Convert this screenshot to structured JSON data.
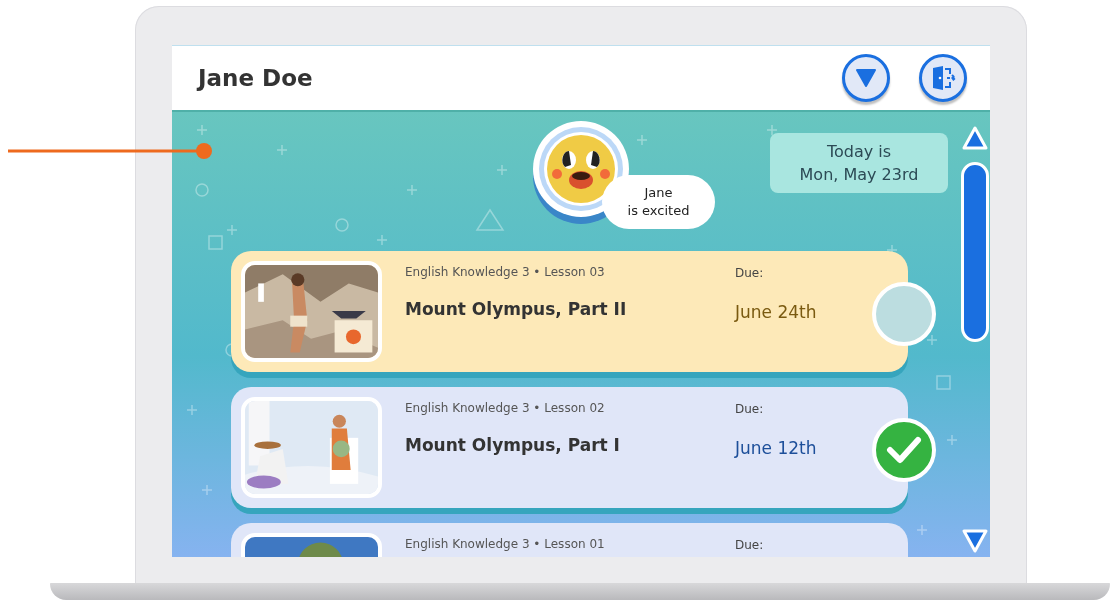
{
  "header": {
    "user_name": "Jane Doe"
  },
  "mood": {
    "name": "Jane",
    "status": "is excited"
  },
  "date": {
    "label": "Today is",
    "value": "Mon, May 23rd"
  },
  "lessons": [
    {
      "course": "English Knowledge 3 • Lesson 03",
      "title": "Mount Olympus, Part II",
      "due_label": "Due:",
      "due": "June 24th",
      "current": true,
      "done": false
    },
    {
      "course": "English Knowledge 3 • Lesson 02",
      "title": "Mount Olympus, Part I",
      "due_label": "Due:",
      "due": "June 12th",
      "current": false,
      "done": true
    },
    {
      "course": "English Knowledge 3 • Lesson 01",
      "due_label": "Due:",
      "current": false
    }
  ]
}
